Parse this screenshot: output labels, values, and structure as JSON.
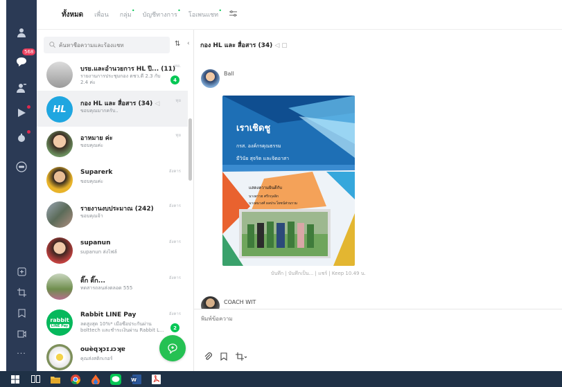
{
  "rail": {
    "unread_badge": "568"
  },
  "tabs": [
    {
      "label": "ทั้งหมด",
      "active": true,
      "star": false
    },
    {
      "label": "เพื่อน",
      "active": false,
      "star": false
    },
    {
      "label": "กลุ่ม",
      "active": false,
      "star": true
    },
    {
      "label": "บัญชีทางการ",
      "active": false,
      "star": true
    },
    {
      "label": "โอเพนแชท",
      "active": false,
      "star": true
    }
  ],
  "search": {
    "placeholder": "ค้นหาชื่อความและร้องแชท"
  },
  "chats": [
    {
      "name": "บรย.และอำนวยการ HL ปี... (11)",
      "msg": "รายงานการประชุมกอง ตชว.ดี 2.3 กับ 2.4 ค่ะ",
      "time": "หย.",
      "count": "4"
    },
    {
      "name": "กอง HL และ สื่อสาร (34)",
      "msg": "ขอบคุณมากครับ..",
      "time": "ทุย",
      "count": ""
    },
    {
      "name": "อาหมาย ค่ะ",
      "msg": "ขอบคุณค่ะ",
      "time": "ทุย",
      "count": ""
    },
    {
      "name": "Suparerk",
      "msg": "ขอบคุณค่ะ",
      "time": "อังคาร",
      "count": ""
    },
    {
      "name": "รายงานงบประมาณ (242)",
      "msg": "ขอบคุณจ้า",
      "time": "อังคาร",
      "count": ""
    },
    {
      "name": "supanun",
      "msg": "supanun ส่งไฟล์",
      "time": "อังคาร",
      "count": ""
    },
    {
      "name": "ติ๊ก ติ๊ก...",
      "msg": "ทดสารถลนส่งตลอด 555",
      "time": "อังคาร",
      "count": ""
    },
    {
      "name": "Rabbit LINE Pay",
      "msg": "ลดสูงสุด 10%* เมื่อซื้อประกันผ่าน bolttech และชำระเงินผ่าน Rabbit L...",
      "time": "อังคาร",
      "count": "2"
    },
    {
      "name": "ouѐqʞɔɪɹɔʞɐ",
      "msg": "คุณส่งสติกเกอร์",
      "time": "",
      "count": ""
    }
  ],
  "chat": {
    "title": "กอง HL และ สื่อสาร (34)",
    "sender": "Ball",
    "poster": {
      "heading": "เราเชิดชู",
      "line1": "กรส. องค์กรคุณธรรม",
      "line2": "มีวินัย สุจริต และจิตอาสา",
      "line3": "แสดงความยินดีกับ",
      "line4": "นางสาวฮ ศรีกกุลลิก",
      "line5": "นางสมวงศ์ ผลประโยชน์ส่วนรวม"
    },
    "meta": "บันทึก | บันทึกเป็น... | แชร์ | Keep  10.49 น.",
    "next_sender": "COACH WIT",
    "input_placeholder": "พิมพ์ข้อความ"
  },
  "colors": {
    "rail": "#2b3a55",
    "accent": "#06c755",
    "taskbar": "#1f3146"
  }
}
